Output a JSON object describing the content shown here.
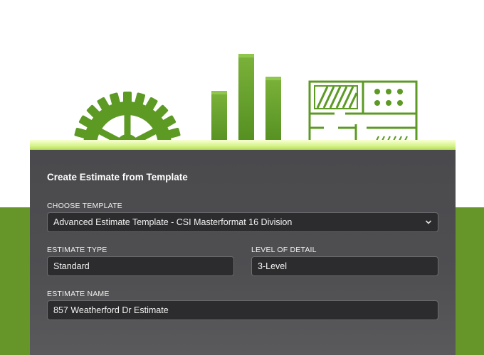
{
  "dialog": {
    "title": "Create Estimate from Template",
    "choose_template": {
      "label": "CHOOSE TEMPLATE",
      "value": "Advanced Estimate Template - CSI Masterformat 16 Division"
    },
    "estimate_type": {
      "label": "ESTIMATE TYPE",
      "value": "Standard"
    },
    "level_of_detail": {
      "label": "LEVEL OF DETAIL",
      "value": "3-Level"
    },
    "estimate_name": {
      "label": "ESTIMATE NAME",
      "value": "857 Weatherford Dr Estimate"
    }
  },
  "colors": {
    "brand_green": "#66962a",
    "panel_bg": "#4d4d50",
    "field_bg": "#2c2c2e"
  },
  "icons": [
    "gear-icon",
    "bar-chart-icon",
    "floor-plan-icon",
    "chevron-down-icon"
  ]
}
